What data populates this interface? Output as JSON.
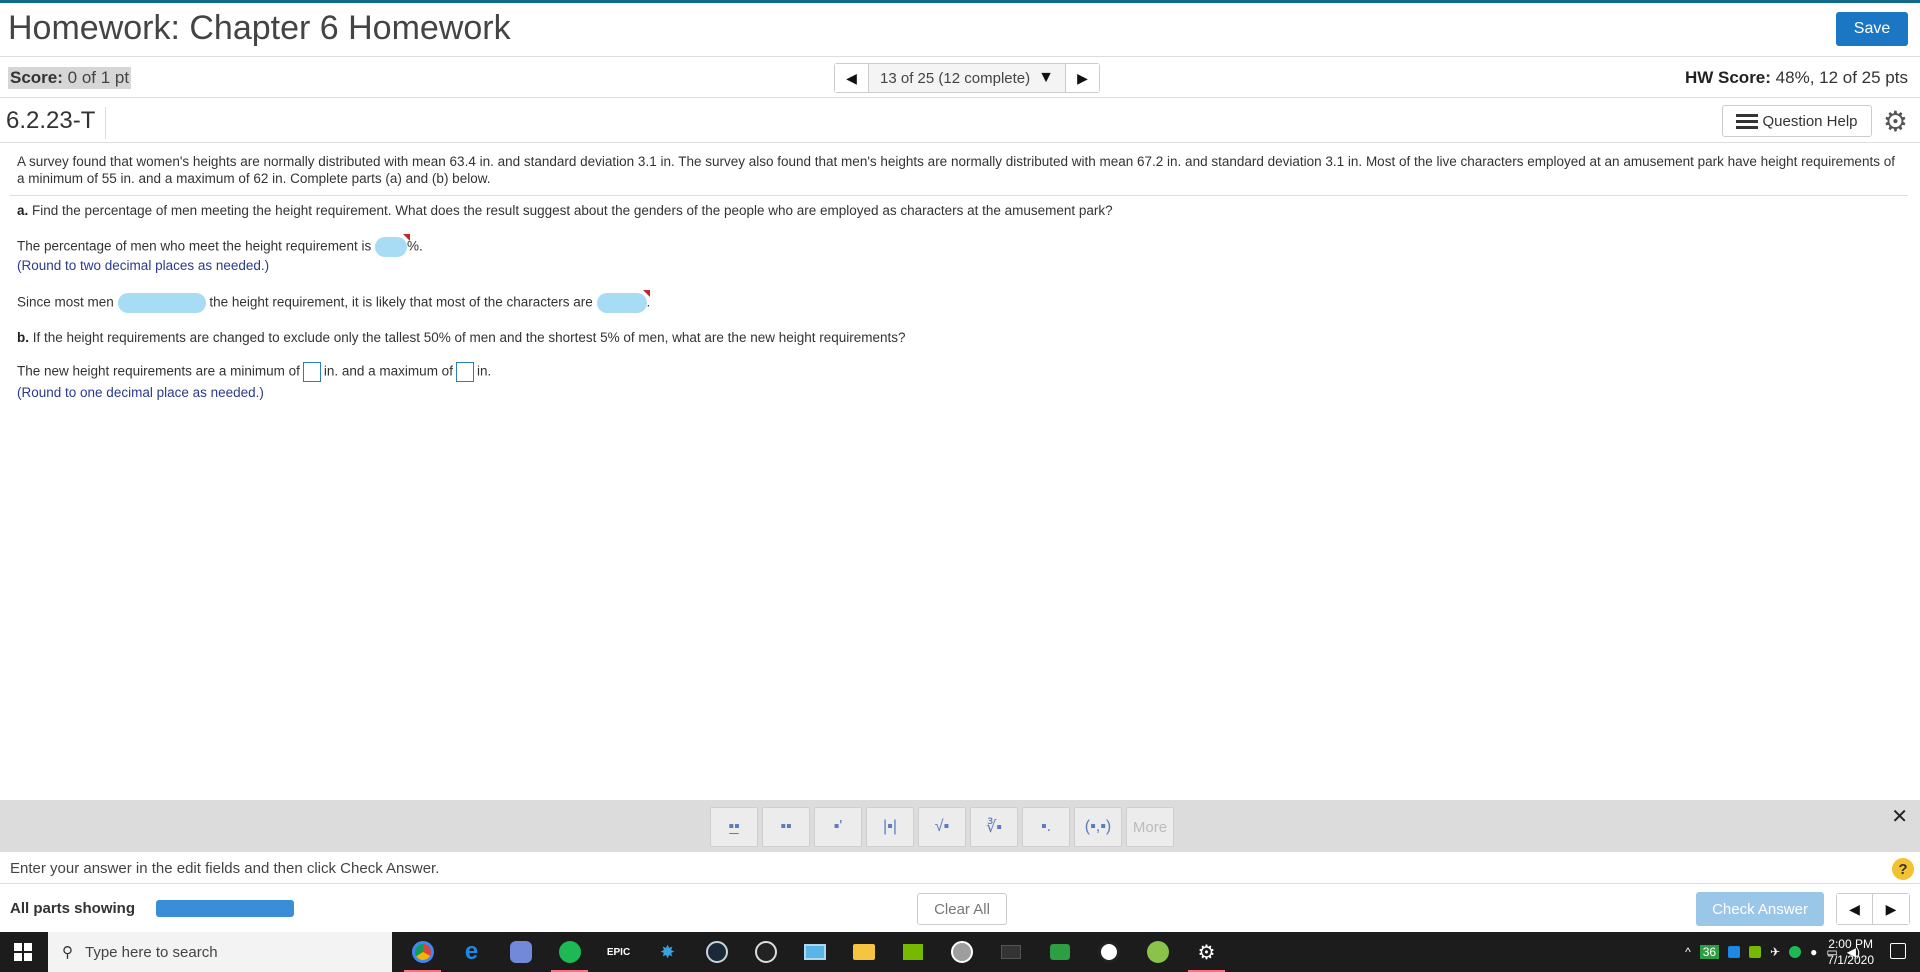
{
  "header": {
    "title": "Homework: Chapter 6 Homework",
    "save_label": "Save"
  },
  "score": {
    "label": "Score:",
    "value": "0 of 1 pt",
    "nav_text": "13 of 25 (12 complete)",
    "hw_label": "HW Score:",
    "hw_value": "48%, 12 of 25 pts"
  },
  "question": {
    "id": "6.2.23-T",
    "help_label": "Question Help",
    "prompt": "A survey found that women's heights are normally distributed with mean 63.4 in. and standard deviation 3.1 in. The survey also found that men's heights are normally distributed with mean 67.2 in. and standard deviation 3.1 in. Most of the live characters employed at an amusement park have height requirements of a minimum of 55 in. and a maximum of 62 in. Complete parts (a) and (b) below.",
    "part_a_label": "a.",
    "part_a_text": "Find the percentage of men meeting the height requirement. What does the result suggest about the genders of the people who are employed as characters at the amusement park?",
    "line1_text": "The percentage of men who meet the height requirement is",
    "line1_suffix": "%.",
    "hint1": "(Round to two decimal places as needed.)",
    "line2_prefix": "Since most men",
    "line2_middle": "the height requirement, it is likely that most of the characters are",
    "line2_suffix": ".",
    "part_b_label": "b.",
    "part_b_text": "If the height requirements are changed to exclude only the tallest 50% of men and the shortest 5% of men, what are the new height requirements?",
    "line3_prefix": "The new height requirements are a minimum of",
    "line3_middle": "in. and a maximum of",
    "line3_suffix": "in.",
    "hint2": "(Round to one decimal place as needed.)"
  },
  "math_toolbar": {
    "tools": [
      {
        "name": "fraction-tool",
        "glyph": "▪̲▪"
      },
      {
        "name": "mixed-number-tool",
        "glyph": "▪▪"
      },
      {
        "name": "exponent-tool",
        "glyph": "▪'"
      },
      {
        "name": "absolute-value-tool",
        "glyph": "|▪|"
      },
      {
        "name": "square-root-tool",
        "glyph": "√▪"
      },
      {
        "name": "nth-root-tool",
        "glyph": "∛▪"
      },
      {
        "name": "decimal-tool",
        "glyph": "▪."
      },
      {
        "name": "ordered-pair-tool",
        "glyph": "(▪,▪)"
      }
    ],
    "more_label": "More"
  },
  "instructions": "Enter your answer in the edit fields and then click Check Answer.",
  "footer": {
    "parts_label": "All parts showing",
    "clear_label": "Clear All",
    "check_label": "Check Answer"
  },
  "taskbar": {
    "search_placeholder": "Type here to search",
    "tray_badge": "36",
    "time": "2:00 PM",
    "date": "7/1/2020",
    "epic_label": "EPIC"
  },
  "colors": {
    "accent": "#1b76c4",
    "answer_highlight": "#a8dcf5",
    "hint_text": "#2a3a8c"
  }
}
